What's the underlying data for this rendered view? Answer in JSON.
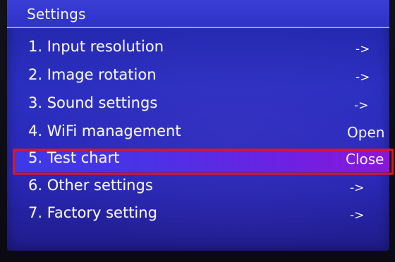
{
  "menu": {
    "title": "Settings",
    "items": [
      {
        "label": "1. Input resolution",
        "value": "->"
      },
      {
        "label": "2. Image rotation",
        "value": "->"
      },
      {
        "label": "3. Sound settings",
        "value": "->"
      },
      {
        "label": "4. WiFi management",
        "value": "Open"
      },
      {
        "label": "5. Test chart",
        "value": "Close"
      },
      {
        "label": "6. Other settings",
        "value": "->"
      },
      {
        "label": "7. Factory setting",
        "value": "->"
      }
    ],
    "selected_index": 4
  },
  "colors": {
    "background": "#2b2fc0",
    "header": "#3a3ed6",
    "highlight_start": "#3d39e6",
    "highlight_end": "#8c16d8",
    "selection_border": "#e1141e",
    "text": "#f3f4ff"
  }
}
